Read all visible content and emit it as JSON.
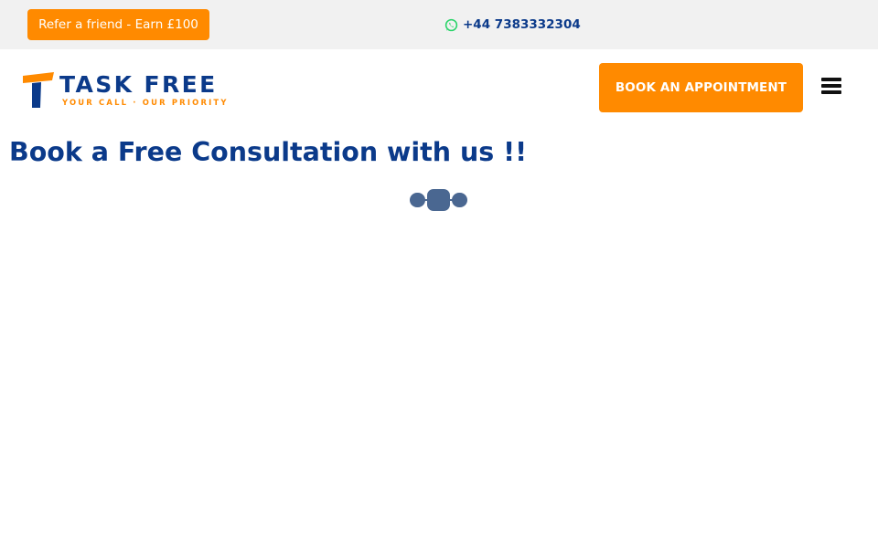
{
  "topbar": {
    "refer_label": "Refer a friend - Earn £100",
    "phone": "+44 7383332304",
    "phone_icon": "whatsapp-icon"
  },
  "header": {
    "logo": {
      "title": "TASK FREE",
      "tagline": "YOUR CALL · OUR PRIORITY"
    },
    "book_label": "BOOK AN APPOINTMENT",
    "menu_icon": "hamburger-menu-icon"
  },
  "main": {
    "title": "Book a Free Consultation with us !!",
    "loader_icon": "loading-spinner-icon"
  },
  "colors": {
    "accent": "#ff8a00",
    "brand_blue": "#0b3a8a",
    "topbar_bg": "#f1f1f1",
    "whatsapp": "#25d366",
    "loader": "#4a6791"
  }
}
